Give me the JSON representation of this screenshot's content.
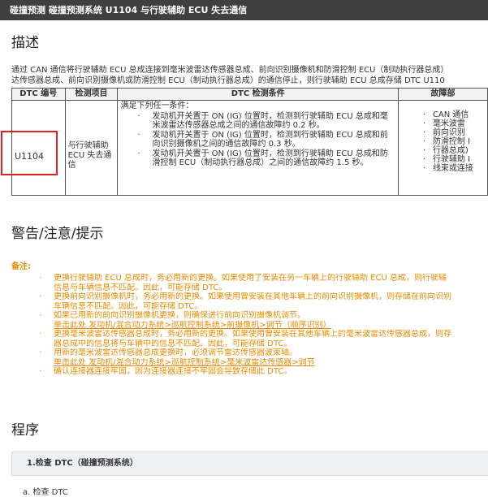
{
  "topbar": {
    "title": "碰撞预测  碰撞预测系统  U1104  与行驶辅助 ECU 失去通信"
  },
  "sections": {
    "description": "描述",
    "warnings": "警告/注意/提示",
    "procedure": "程序"
  },
  "description_text": [
    "通过 CAN 通信将行驶辅助 ECU 总成连接到毫米波雷达传感器总成、前向识别摄像机和防滑控制 ECU（制动执行器总成）",
    "达传感器总成、前向识别摄像机或防滑控制 ECU（制动执行器总成）的通信停止，则行驶辅助 ECU 总成存储 DTC U110"
  ],
  "table": {
    "headers": [
      "DTC 编号",
      "检测项目",
      "DTC 检测条件",
      "故障部"
    ],
    "code": "U1104",
    "item": "与行驶辅助 ECU 失去通信",
    "condition_lead": "满足下列任一条件：",
    "conditions": [
      "发动机开关置于 ON (IG) 位置时，检测到行驶辅助 ECU 总成和毫米波雷达传感器总成之间的通信故障约 0.2 秒。",
      "发动机开关置于 ON (IG) 位置时，检测到行驶辅助 ECU 总成和前向识别摄像机之间的通信故障约 0.3 秒。",
      "发动机开关置于 ON (IG) 位置时，检测到行驶辅助 ECU 总成和防滑控制 ECU（制动执行器总成）之间的通信故障约 1.5 秒。"
    ],
    "faults": [
      "CAN 通信",
      "毫米波雷",
      "前向识别",
      "防滑控制 I",
      "行器总成)",
      "行驶辅助 I",
      "线束或连接"
    ]
  },
  "notes_label": "备注:",
  "notes": [
    {
      "text": "更换行驶辅助 ECU 总成时，务必用新的更换。如果使用了安装在另一车辆上的行驶辅助 ECU 总成，则行驶辅",
      "bullet": true
    },
    {
      "text": "信息与车辆信息不匹配。因此，可能存储 DTC。",
      "bullet": false
    },
    {
      "text": "更换前向识别摄像机时，务必用新的更换。如果使用曾安装在其他车辆上的前向识别摄像机，则存储在前向识别",
      "bullet": true
    },
    {
      "text": "车辆信息不匹配。因此，可能存储 DTC。",
      "bullet": false
    },
    {
      "text": "如果已用新的前向识别摄像机更换，则确保进行前向识别摄像机调节。",
      "bullet": true
    },
    {
      "text": "单击此处 发动机/混合动力系统>巡航控制系统>前摄像机>调节（顺序识别）",
      "bullet": false,
      "link": true
    },
    {
      "text": "更换毫米波雷达传感器总成时，务必用新的更换。如果使用曾安装在其他车辆上的毫米波雷达传感器总成，则存",
      "bullet": true
    },
    {
      "text": "器总成中的信息将与车辆中的信息不匹配。因此，可能存储 DTC。",
      "bullet": false
    },
    {
      "text": "用新的毫米波雷达传感器总成更换时，必须调节雷达传感器波束轴。",
      "bullet": true
    },
    {
      "text": "单击此处 发动机/混合动力系统>巡航控制系统>毫米波雷达传感器>调节",
      "bullet": false,
      "link": true
    },
    {
      "text": "确认连接器连接牢固，因为连接器连接不牢固会导致存储此 DTC。",
      "bullet": true
    }
  ],
  "procedure_step": "1.检查 DTC（碰撞预测系统）",
  "step_text": "检查 DTC"
}
